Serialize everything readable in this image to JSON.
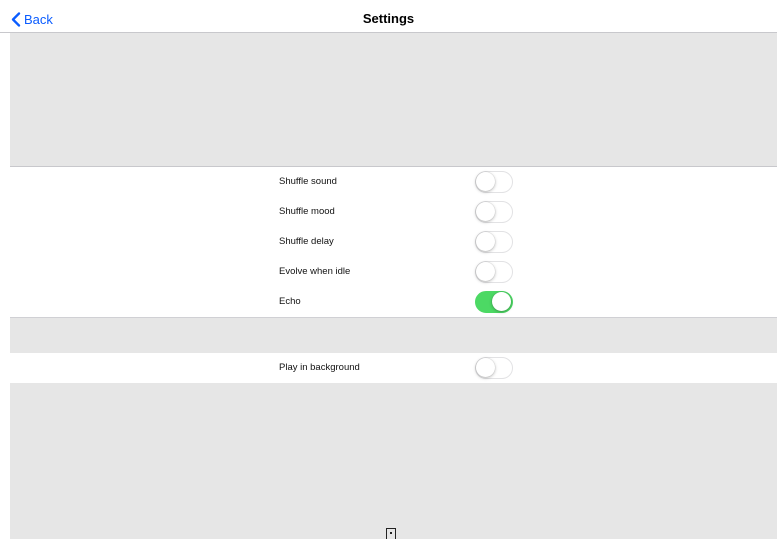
{
  "nav": {
    "back_label": "Back",
    "title": "Settings"
  },
  "colors": {
    "accent": "#0a5cff",
    "toggle_on": "#4cd964",
    "group_background": "#e6e6e6"
  },
  "settings": [
    {
      "label": "Shuffle sound",
      "enabled": false
    },
    {
      "label": "Shuffle mood",
      "enabled": false
    },
    {
      "label": "Shuffle delay",
      "enabled": false
    },
    {
      "label": "Evolve when idle",
      "enabled": false
    },
    {
      "label": "Echo",
      "enabled": true
    }
  ],
  "background_settings": [
    {
      "label": "Play in background",
      "enabled": false
    }
  ]
}
